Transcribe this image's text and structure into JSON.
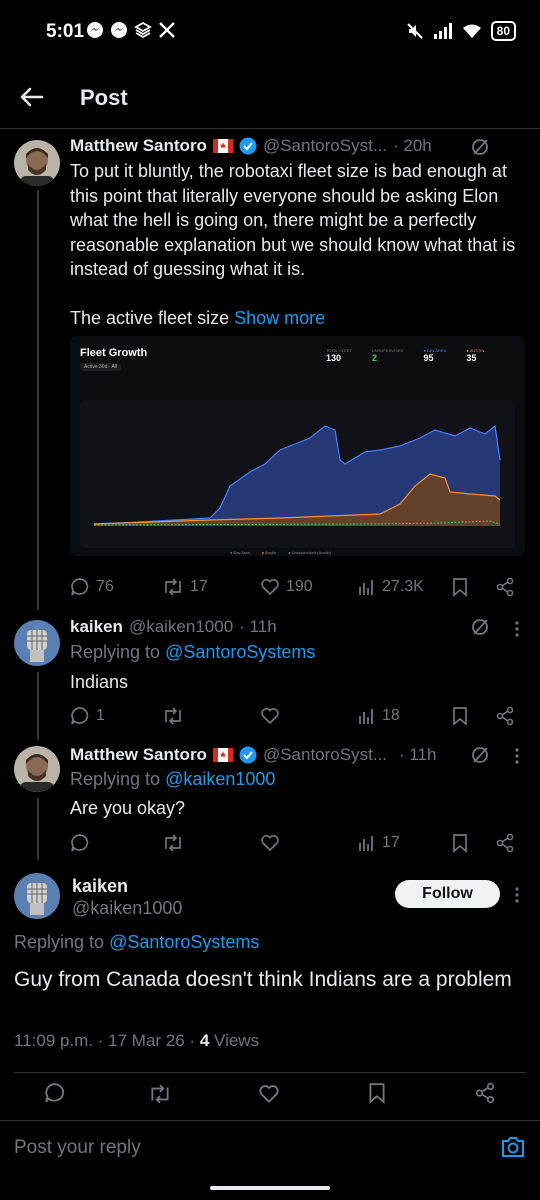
{
  "status_bar": {
    "time": "5:01",
    "battery": "80"
  },
  "header": {
    "title": "Post"
  },
  "tweet1": {
    "name": "Matthew Santoro",
    "handle": "@SantoroSyst...",
    "time": "· 20h",
    "text": "To put it bluntly, the robotaxi fleet size is bad enough at this point that literally everyone should be asking Elon what the hell is going on, there might be a perfectly reasonable explanation but we should know what that is instead of guessing what it is.",
    "text2": "The active fleet size",
    "show_more": "Show more",
    "chart": {
      "title": "Fleet Growth",
      "dropdown": "Active 30d · All",
      "stats": [
        {
          "label": "TOTAL FLEET",
          "value": "130",
          "color": "#ffffff"
        },
        {
          "label": "UNSUPERVISED",
          "value": "2",
          "color": "#2ecc71"
        },
        {
          "label": "● BAY AREA",
          "value": "95",
          "color": "#ffffff"
        },
        {
          "label": "● AUSTIN",
          "value": "35",
          "color": "#ffffff"
        }
      ],
      "legend": [
        "Bay Area",
        "Austin",
        "Unsupervised (Austin)"
      ],
      "series_colors": [
        "#4a7cff",
        "#f0923a",
        "#2ecc71"
      ]
    },
    "replies": "76",
    "reposts": "17",
    "likes": "190",
    "views": "27.3K"
  },
  "reply1": {
    "name": "kaiken",
    "handle": "@kaiken1000",
    "time": "· 11h",
    "replying_prefix": "Replying to",
    "replying_to": "@SantoroSystems",
    "text": "Indians",
    "replies": "1",
    "views": "18"
  },
  "reply2": {
    "name": "Matthew Santoro",
    "handle": "@SantoroSyst...",
    "time": "· 11h",
    "replying_prefix": "Replying to",
    "replying_to": "@kaiken1000",
    "text": "Are you okay?",
    "views": "17"
  },
  "main_post": {
    "name": "kaiken",
    "handle": "@kaiken1000",
    "follow_label": "Follow",
    "replying_prefix": "Replying to",
    "replying_to": "@SantoroSystems",
    "text": "Guy from Canada doesn't think Indians are a problem",
    "timestamp": "11:09 p.m. · 17 Mar 26 ·",
    "views_count": "4",
    "views_label": "Views"
  },
  "reply_bar": {
    "placeholder": "Post your reply"
  }
}
